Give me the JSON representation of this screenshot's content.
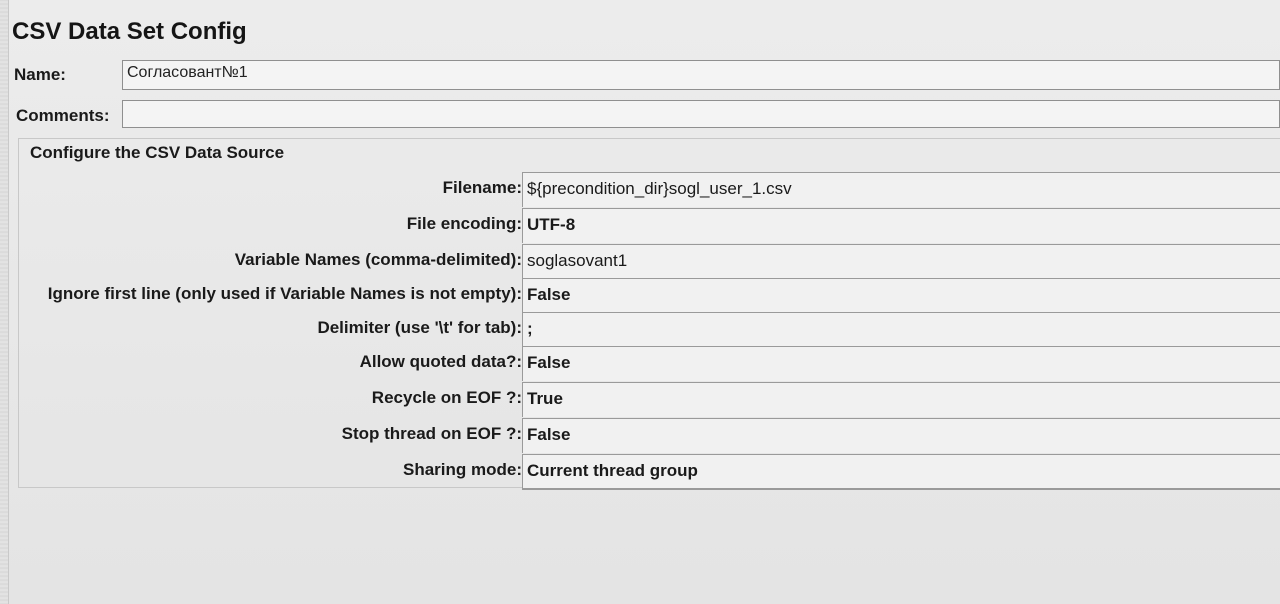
{
  "title": "CSV Data Set Config",
  "name": {
    "label": "Name:",
    "value": "Согласовант№1"
  },
  "comments": {
    "label": "Comments:",
    "value": ""
  },
  "group": {
    "title": "Configure the CSV Data Source"
  },
  "properties": [
    {
      "label": "Filename:",
      "value": "${precondition_dir}sogl_user_1.csv"
    },
    {
      "label": "File encoding:",
      "value": "UTF-8"
    },
    {
      "label": "Variable Names (comma-delimited):",
      "value": "soglasovant1"
    },
    {
      "label": "Ignore first line (only used if Variable Names is not empty):",
      "value": "False"
    },
    {
      "label": "Delimiter (use '\\t' for tab):",
      "value": ";"
    },
    {
      "label": "Allow quoted data?:",
      "value": "False"
    },
    {
      "label": "Recycle on EOF ?:",
      "value": "True"
    },
    {
      "label": "Stop thread on EOF ?:",
      "value": "False"
    },
    {
      "label": "Sharing mode:",
      "value": "Current thread group"
    }
  ]
}
